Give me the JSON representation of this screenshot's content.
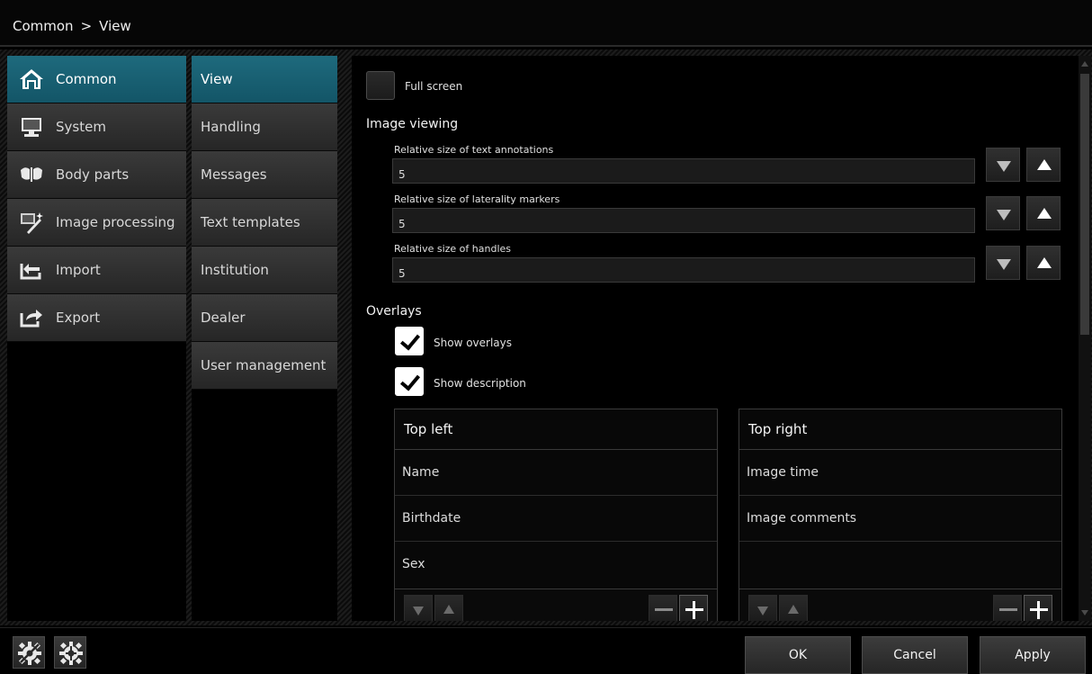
{
  "breadcrumb": {
    "root": "Common",
    "separator": ">",
    "current": "View"
  },
  "categories": [
    {
      "label": "Common",
      "icon": "home-icon",
      "active": true
    },
    {
      "label": "System",
      "icon": "monitor-icon",
      "active": false
    },
    {
      "label": "Body parts",
      "icon": "body-parts-icon",
      "active": false
    },
    {
      "label": "Image processing",
      "icon": "image-processing-icon",
      "active": false
    },
    {
      "label": "Import",
      "icon": "import-icon",
      "active": false
    },
    {
      "label": "Export",
      "icon": "export-icon",
      "active": false
    }
  ],
  "subcategories": [
    {
      "label": "View",
      "active": true
    },
    {
      "label": "Handling",
      "active": false
    },
    {
      "label": "Messages",
      "active": false
    },
    {
      "label": "Text templates",
      "active": false
    },
    {
      "label": "Institution",
      "active": false
    },
    {
      "label": "Dealer",
      "active": false
    },
    {
      "label": "User management",
      "active": false
    }
  ],
  "settings": {
    "full_screen": {
      "label": "Full screen",
      "checked": false
    },
    "image_viewing": {
      "title": "Image viewing",
      "fields": [
        {
          "label": "Relative size of text annotations",
          "value": "5"
        },
        {
          "label": "Relative size of laterality markers",
          "value": "5"
        },
        {
          "label": "Relative size of handles",
          "value": "5"
        }
      ]
    },
    "overlays": {
      "title": "Overlays",
      "show_overlays": {
        "label": "Show overlays",
        "checked": true
      },
      "show_description": {
        "label": "Show description",
        "checked": true
      },
      "top_left": {
        "header": "Top left",
        "items": [
          "Name",
          "Birthdate",
          "Sex"
        ]
      },
      "top_right": {
        "header": "Top right",
        "items": [
          "Image time",
          "Image comments",
          ""
        ]
      }
    }
  },
  "footer": {
    "ok": "OK",
    "cancel": "Cancel",
    "apply": "Apply"
  },
  "colors": {
    "accent": "#1a6276",
    "background": "#000000",
    "button": "#303030"
  }
}
